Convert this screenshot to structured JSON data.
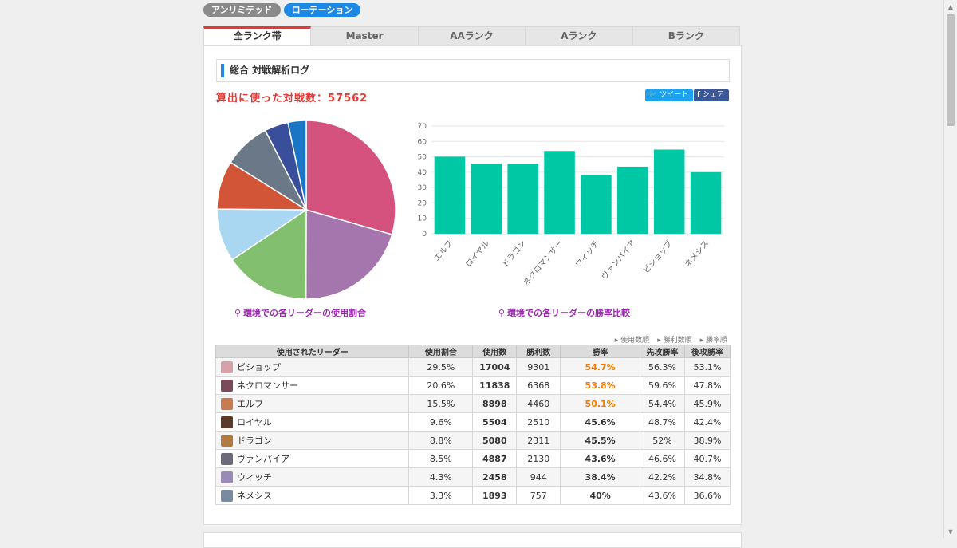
{
  "format_pills": [
    "アンリミテッド",
    "ローテーション"
  ],
  "rank_tabs": [
    "全ランク帯",
    "Master",
    "AAランク",
    "Aランク",
    "Bランク"
  ],
  "section_title": "総合 対戦解析ログ",
  "battle_count_label": "算出に使った対戦数：57562",
  "share": {
    "tweet": "ツイート",
    "share": "シェア"
  },
  "chart_captions": {
    "pie": "環境での各リーダーの使用割合",
    "bar": "環境での各リーダーの勝率比較"
  },
  "sort_links": [
    "使用数順",
    "勝利数順",
    "勝率順"
  ],
  "table": {
    "headers": [
      "使用されたリーダー",
      "使用割合",
      "使用数",
      "勝利数",
      "勝率",
      "先攻勝率",
      "後攻勝率"
    ],
    "rows": [
      [
        "ビショップ",
        "29.5%",
        "17004",
        "9301",
        "54.7%",
        "56.3%",
        "53.1%"
      ],
      [
        "ネクロマンサー",
        "20.6%",
        "11838",
        "6368",
        "53.8%",
        "59.6%",
        "47.8%"
      ],
      [
        "エルフ",
        "15.5%",
        "8898",
        "4460",
        "50.1%",
        "54.4%",
        "45.9%"
      ],
      [
        "ロイヤル",
        "9.6%",
        "5504",
        "2510",
        "45.6%",
        "48.7%",
        "42.4%"
      ],
      [
        "ドラゴン",
        "8.8%",
        "5080",
        "2311",
        "45.5%",
        "52%",
        "38.9%"
      ],
      [
        "ヴァンパイア",
        "8.5%",
        "4887",
        "2130",
        "43.6%",
        "46.6%",
        "40.7%"
      ],
      [
        "ウィッチ",
        "4.3%",
        "2458",
        "944",
        "38.4%",
        "42.2%",
        "34.8%"
      ],
      [
        "ネメシス",
        "3.3%",
        "1893",
        "757",
        "40%",
        "43.6%",
        "36.6%"
      ]
    ],
    "highlight_rows": [
      0,
      1,
      2
    ]
  },
  "colors": {
    "pie": [
      "#d4527d",
      "#a576ad",
      "#82bf6e",
      "#a9d6f0",
      "#d25537",
      "#6b7887",
      "#3a4f9c",
      "#1a76c4"
    ],
    "bar": "#00c8a5",
    "avatars": [
      "#d8a0a8",
      "#7a4a5a",
      "#c87a50",
      "#5a3a2a",
      "#b07a40",
      "#6a6a7a",
      "#9a8ab8",
      "#7a8aa0"
    ]
  },
  "chart_data": [
    {
      "type": "pie",
      "title": "環境での各リーダーの使用割合",
      "categories": [
        "ビショップ",
        "ネクロマンサー",
        "エルフ",
        "ロイヤル",
        "ドラゴン",
        "ヴァンパイア",
        "ウィッチ",
        "ネメシス"
      ],
      "values": [
        29.5,
        20.6,
        15.5,
        9.6,
        8.8,
        8.5,
        4.3,
        3.3
      ]
    },
    {
      "type": "bar",
      "title": "環境での各リーダーの勝率比較",
      "categories": [
        "エルフ",
        "ロイヤル",
        "ドラゴン",
        "ネクロマンサー",
        "ウィッチ",
        "ヴァンパイア",
        "ビショップ",
        "ネメシス"
      ],
      "values": [
        50.1,
        45.6,
        45.5,
        53.8,
        38.4,
        43.6,
        54.7,
        40
      ],
      "yticks": [
        0,
        10,
        20,
        30,
        40,
        50,
        60,
        70
      ],
      "ylim": [
        0,
        70
      ],
      "grid": true
    }
  ]
}
